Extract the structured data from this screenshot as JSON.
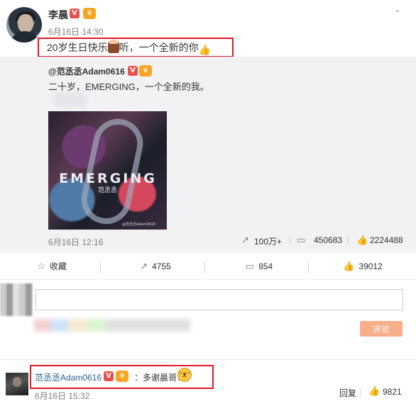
{
  "post": {
    "author": "李晨",
    "time": "6月16日 14:30",
    "text_before": "20岁生日快乐",
    "text_mid": "听，一个全新的你",
    "verified_badge": "V"
  },
  "repost": {
    "author": "@范丞丞Adam0616",
    "text": "二十岁，EMERGING，一个全新的我。",
    "cover_title": "EMERGING",
    "cover_sub": "范丞丞",
    "cover_credit": "@范丞丞Adam0616",
    "time": "6月16日 12:16",
    "reposts": "100万+",
    "comments": "450683",
    "likes": "2224488"
  },
  "actions": {
    "favorite": "收藏",
    "repost": "4755",
    "comment": "854",
    "like": "39012"
  },
  "composer": {
    "submit": "评论"
  },
  "reply": {
    "author": "范丞丞Adam0616",
    "text": "：多谢晨哥！",
    "time": "6月16日 15:32",
    "reply_label": "回复",
    "likes": "9821"
  },
  "colors": {
    "highlight_box": "#e0182a",
    "link": "#2a6496",
    "submit_disabled": "#f8ae8a"
  }
}
